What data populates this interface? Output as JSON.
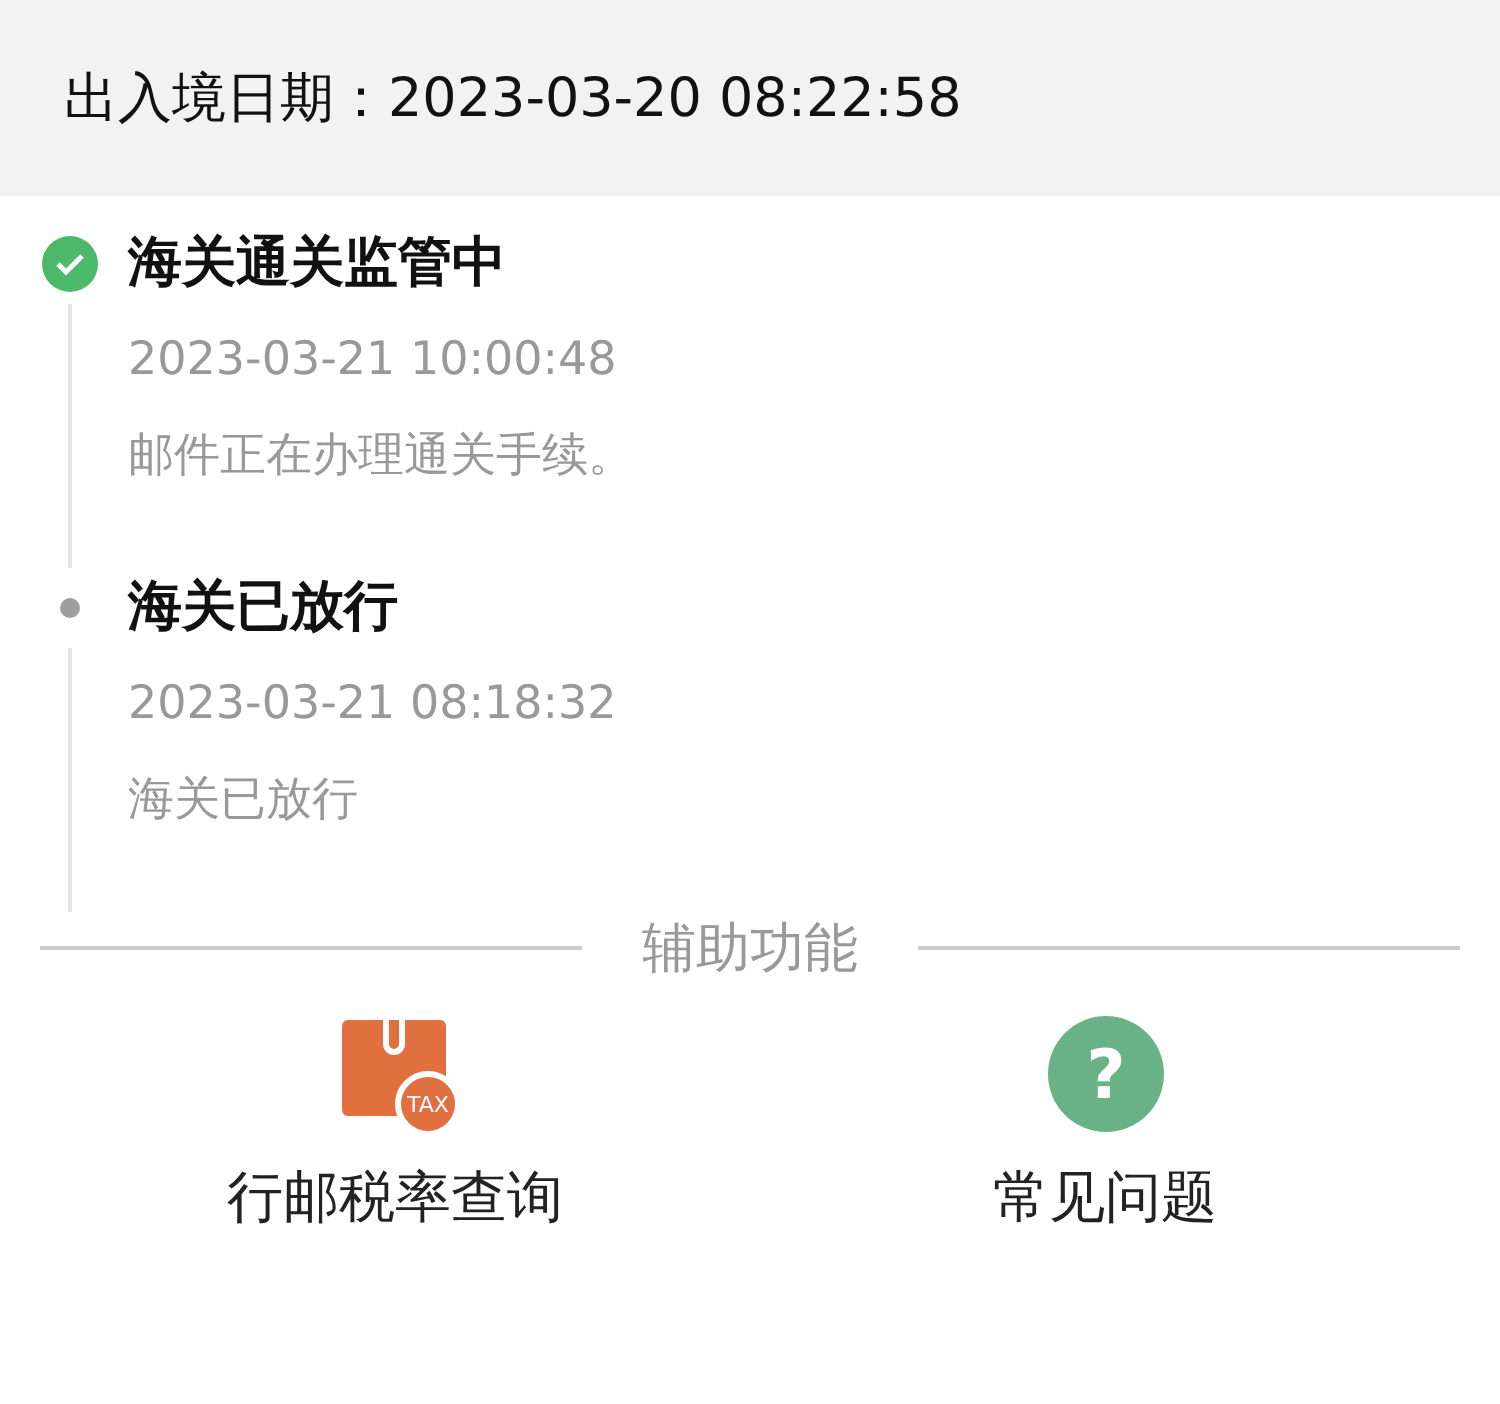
{
  "header": {
    "label": "出入境日期：",
    "value": "2023-03-20 08:22:58"
  },
  "events": [
    {
      "kind": "done",
      "title": "海关通关监管中",
      "time": "2023-03-21 10:00:48",
      "description": "邮件正在办理通关手续。"
    },
    {
      "kind": "normal",
      "title": "海关已放行",
      "time": "2023-03-21 08:18:32",
      "description": "海关已放行"
    }
  ],
  "section_title": "辅助功能",
  "tools": [
    {
      "kind": "tax",
      "icon_text": "TAX",
      "label": "行邮税率查询"
    },
    {
      "kind": "help",
      "icon_text": "?",
      "label": "常见问题"
    }
  ]
}
